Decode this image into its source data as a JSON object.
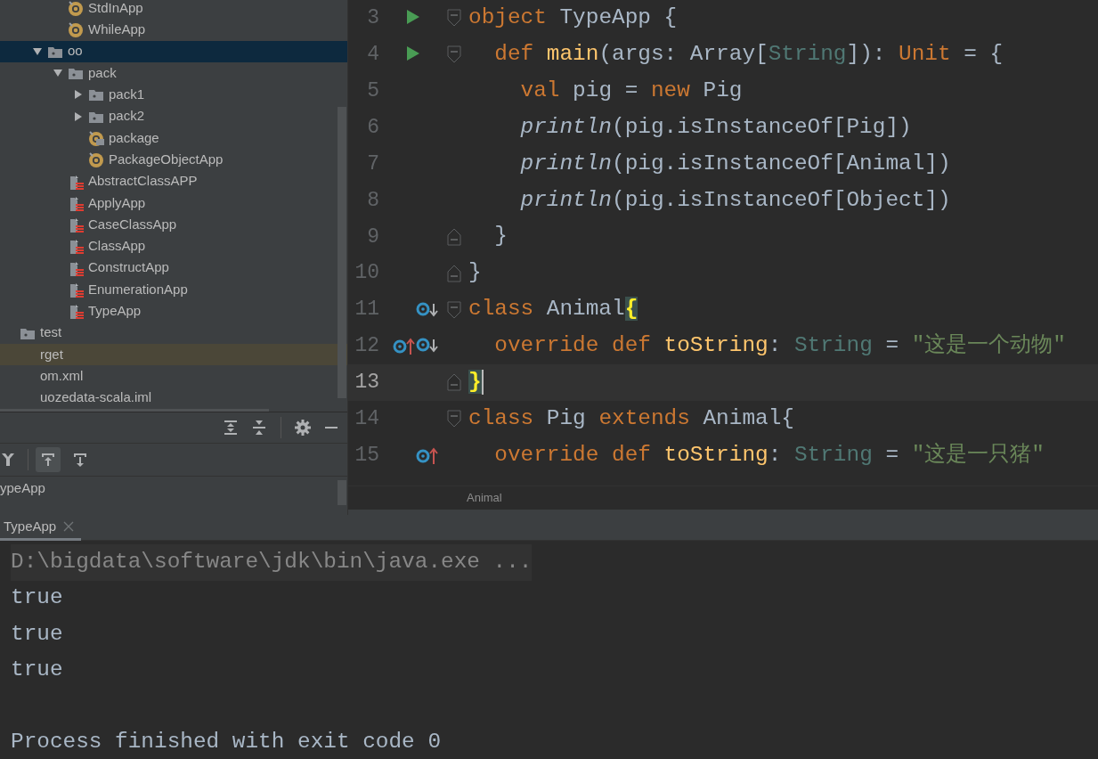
{
  "project_tree": {
    "scrolled_branch": [
      {
        "label": "StdInApp",
        "kind": "object"
      },
      {
        "label": "WhileApp",
        "kind": "object"
      }
    ],
    "items": [
      {
        "label": "oo",
        "kind": "folder",
        "expanded": true,
        "selected": true,
        "children": [
          {
            "label": "pack",
            "kind": "folder",
            "expanded": true,
            "selected": false,
            "children": [
              {
                "label": "pack1",
                "kind": "folder",
                "expanded": false,
                "selected": false
              },
              {
                "label": "pack2",
                "kind": "folder",
                "expanded": false,
                "selected": false
              },
              {
                "label": "package",
                "kind": "package-object",
                "selected": false
              },
              {
                "label": "PackageObjectApp",
                "kind": "object",
                "selected": false
              }
            ]
          },
          {
            "label": "AbstractClassAPP",
            "kind": "scala-file",
            "selected": false
          },
          {
            "label": "ApplyApp",
            "kind": "scala-file",
            "selected": false
          },
          {
            "label": "CaseClassApp",
            "kind": "scala-file",
            "selected": false
          },
          {
            "label": "ClassApp",
            "kind": "scala-file",
            "selected": false
          },
          {
            "label": "ConstructApp",
            "kind": "scala-file",
            "selected": false
          },
          {
            "label": "EnumerationApp",
            "kind": "scala-file",
            "selected": false
          },
          {
            "label": "TypeApp",
            "kind": "scala-file",
            "selected": false
          }
        ]
      }
    ],
    "outer_items": [
      {
        "label": "test",
        "kind": "folder",
        "excluded": false
      },
      {
        "label": "rget",
        "kind": "cut",
        "excluded": true
      },
      {
        "label": "om.xml",
        "kind": "cut",
        "excluded": false
      },
      {
        "label": "uozedata-scala.iml",
        "kind": "cut",
        "excluded": false
      }
    ]
  },
  "structure_toolbar": [
    {
      "kind": "filter",
      "selected": false
    },
    {
      "kind": "scroll-from",
      "selected": true
    },
    {
      "kind": "scroll-to",
      "selected": false
    }
  ],
  "structure_list": [
    {
      "label": "ypeApp"
    }
  ],
  "editor": {
    "lines": [
      {
        "number": "3",
        "current": false,
        "markers": [
          {
            "kind": "run"
          }
        ],
        "fold": {
          "kind": "start"
        },
        "tokens": [
          {
            "kind": "kw",
            "text": "object"
          },
          {
            "kind": "plain",
            "text": " TypeApp {"
          }
        ]
      },
      {
        "number": "4",
        "current": false,
        "markers": [
          {
            "kind": "run"
          }
        ],
        "fold": {
          "kind": "start"
        },
        "tokens": [
          {
            "kind": "kw",
            "text": "  def "
          },
          {
            "kind": "fn",
            "text": "main"
          },
          {
            "kind": "plain",
            "text": "(args: Array["
          },
          {
            "kind": "type",
            "text": "String"
          },
          {
            "kind": "plain",
            "text": "]): "
          },
          {
            "kind": "kw",
            "text": "Unit"
          },
          {
            "kind": "plain",
            "text": " = {"
          }
        ]
      },
      {
        "number": "5",
        "current": false,
        "tokens": [
          {
            "kind": "kw",
            "text": "    val"
          },
          {
            "kind": "plain",
            "text": " pig = "
          },
          {
            "kind": "kw",
            "text": "new"
          },
          {
            "kind": "plain",
            "text": " Pig"
          }
        ]
      },
      {
        "number": "6",
        "current": false,
        "tokens": [
          {
            "kind": "italic",
            "text": "    println"
          },
          {
            "kind": "plain",
            "text": "(pig.isInstanceOf[Pig])"
          }
        ]
      },
      {
        "number": "7",
        "current": false,
        "tokens": [
          {
            "kind": "italic",
            "text": "    println"
          },
          {
            "kind": "plain",
            "text": "(pig.isInstanceOf[Animal])"
          }
        ]
      },
      {
        "number": "8",
        "current": false,
        "tokens": [
          {
            "kind": "italic",
            "text": "    println"
          },
          {
            "kind": "plain",
            "text": "(pig.isInstanceOf[Object])"
          }
        ]
      },
      {
        "number": "9",
        "current": false,
        "fold": {
          "kind": "end"
        },
        "tokens": [
          {
            "kind": "plain",
            "text": "  }"
          }
        ]
      },
      {
        "number": "10",
        "current": false,
        "fold": {
          "kind": "end"
        },
        "tokens": [
          {
            "kind": "plain",
            "text": "}"
          }
        ]
      },
      {
        "number": "11",
        "current": false,
        "markers": [
          {
            "kind": "implemented"
          }
        ],
        "fold": {
          "kind": "start"
        },
        "tokens": [
          {
            "kind": "kw",
            "text": "class"
          },
          {
            "kind": "plain",
            "text": " Animal"
          },
          {
            "kind": "match",
            "text": "{"
          }
        ]
      },
      {
        "number": "12",
        "current": false,
        "markers": [
          {
            "kind": "overrides"
          },
          {
            "kind": "implemented"
          }
        ],
        "tokens": [
          {
            "kind": "kw",
            "text": "  override def "
          },
          {
            "kind": "fn",
            "text": "toString"
          },
          {
            "kind": "plain",
            "text": ": "
          },
          {
            "kind": "type",
            "text": "String"
          },
          {
            "kind": "plain",
            "text": " = "
          },
          {
            "kind": "str",
            "text": "\"这是一个动物\""
          }
        ]
      },
      {
        "number": "13",
        "current": true,
        "fold": {
          "kind": "end"
        },
        "tokens": [
          {
            "kind": "match",
            "text": "}"
          }
        ]
      },
      {
        "number": "14",
        "current": false,
        "fold": {
          "kind": "start"
        },
        "tokens": [
          {
            "kind": "kw",
            "text": "class"
          },
          {
            "kind": "plain",
            "text": " Pig "
          },
          {
            "kind": "kw",
            "text": "extends"
          },
          {
            "kind": "plain",
            "text": " Animal{"
          }
        ]
      },
      {
        "number": "15",
        "current": false,
        "markers": [
          {
            "kind": "overrides"
          }
        ],
        "tokens": [
          {
            "kind": "kw",
            "text": "  override def "
          },
          {
            "kind": "fn",
            "text": "toString"
          },
          {
            "kind": "plain",
            "text": ": "
          },
          {
            "kind": "type",
            "text": "String"
          },
          {
            "kind": "plain",
            "text": " = "
          },
          {
            "kind": "str",
            "text": "\"这是一只猪\""
          }
        ]
      }
    ],
    "breadcrumb": "Animal"
  },
  "run_panel": {
    "tabs": [
      {
        "label": "TypeApp",
        "selected": true
      }
    ],
    "console": [
      {
        "kind": "command",
        "text": "D:\\bigdata\\software\\jdk\\bin\\java.exe ..."
      },
      {
        "kind": "output",
        "text": "true"
      },
      {
        "kind": "output",
        "text": "true"
      },
      {
        "kind": "output",
        "text": "true"
      },
      {
        "kind": "blank"
      },
      {
        "kind": "output",
        "text": "Process finished with exit code 0"
      }
    ]
  }
}
